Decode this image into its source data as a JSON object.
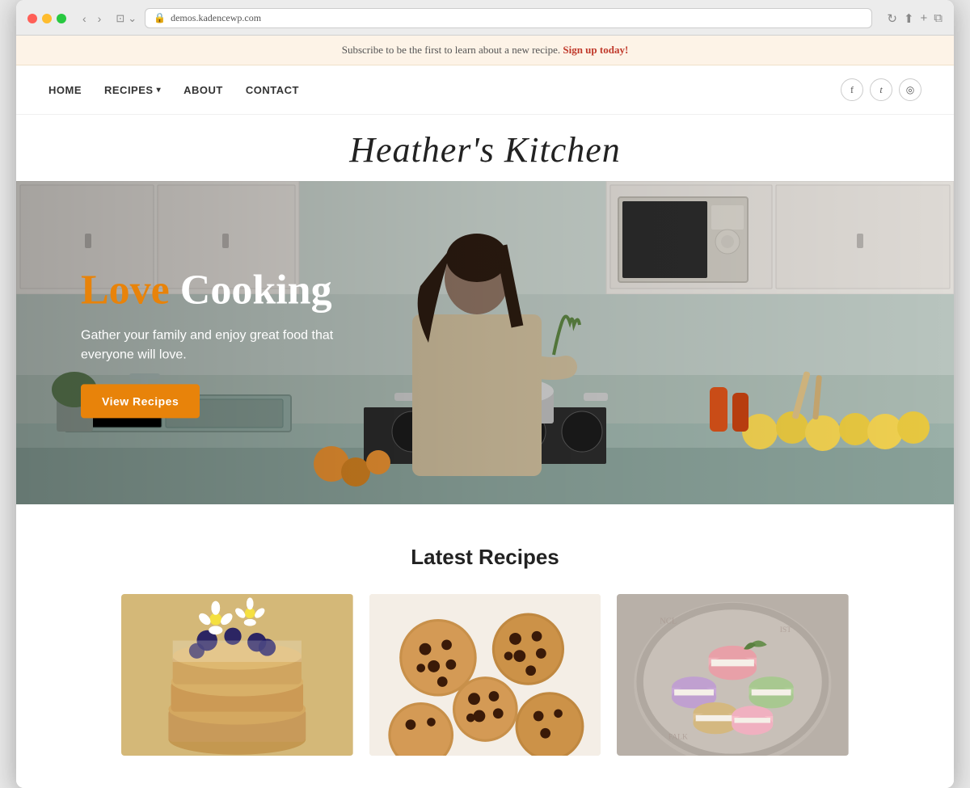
{
  "browser": {
    "url": "demos.kadencewp.com",
    "tab_icon": "🔒",
    "nav_back": "‹",
    "nav_forward": "›",
    "reload": "↻",
    "share_icon": "⬆",
    "new_tab_icon": "+",
    "copy_icon": "⧉"
  },
  "banner": {
    "text": "Subscribe to be the first to learn about a new recipe.",
    "link_text": "Sign up today!",
    "link_url": "#"
  },
  "nav": {
    "links": [
      {
        "label": "HOME",
        "url": "#",
        "has_dropdown": false
      },
      {
        "label": "RECIPES",
        "url": "#",
        "has_dropdown": true
      },
      {
        "label": "ABOUT",
        "url": "#",
        "has_dropdown": false
      },
      {
        "label": "CONTACT",
        "url": "#",
        "has_dropdown": false
      }
    ],
    "social": [
      {
        "icon": "f",
        "label": "Facebook",
        "url": "#"
      },
      {
        "icon": "t",
        "label": "Twitter",
        "url": "#"
      },
      {
        "icon": "◎",
        "label": "Instagram",
        "url": "#"
      }
    ]
  },
  "site_title": "Heather's Kitchen",
  "hero": {
    "title_love": "Love",
    "title_cooking": " Cooking",
    "subtitle": "Gather your family and enjoy great food that everyone will love.",
    "button_label": "View Recipes",
    "button_url": "#"
  },
  "latest_recipes": {
    "section_title": "Latest Recipes",
    "recipes": [
      {
        "id": "pancakes",
        "alt": "Pancakes with blueberries and daisies"
      },
      {
        "id": "cookies",
        "alt": "Chocolate chip cookies"
      },
      {
        "id": "macarons",
        "alt": "Colorful macarons on a plate"
      }
    ]
  }
}
